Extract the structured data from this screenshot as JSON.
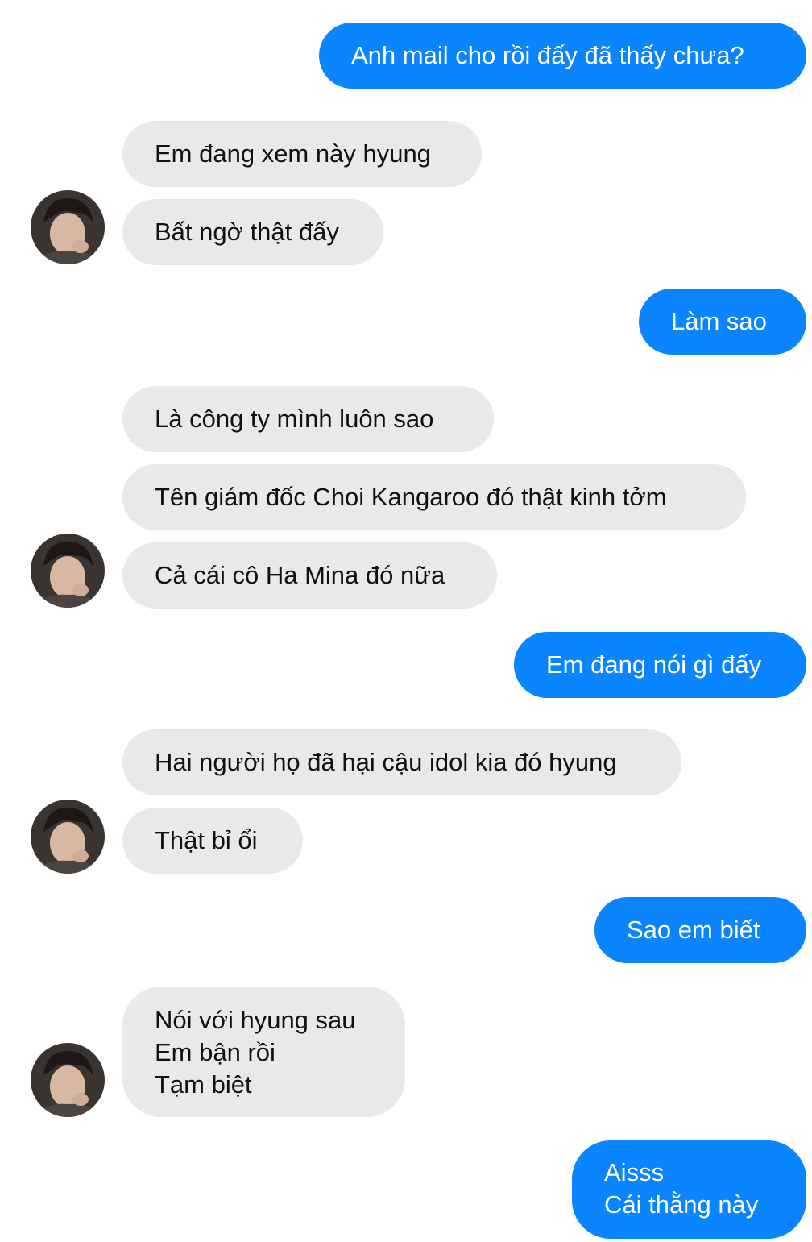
{
  "messages": [
    {
      "sender": "me",
      "text": "Anh mail cho rồi đấy đã thấy chưa?"
    },
    {
      "sender": "contact",
      "text": "Em đang xem này hyung"
    },
    {
      "sender": "contact",
      "text": "Bất ngờ thật đấy"
    },
    {
      "sender": "me",
      "text": "Làm sao"
    },
    {
      "sender": "contact",
      "text": "Là công ty mình luôn sao"
    },
    {
      "sender": "contact",
      "text": "Tên giám đốc Choi Kangaroo đó thật kinh tởm"
    },
    {
      "sender": "contact",
      "text": "Cả cái cô Ha Mina đó nữa"
    },
    {
      "sender": "me",
      "text": "Em đang nói gì đấy"
    },
    {
      "sender": "contact",
      "text": "Hai người họ đã hại cậu idol kia đó hyung"
    },
    {
      "sender": "contact",
      "text": "Thật bỉ ổi"
    },
    {
      "sender": "me",
      "text": "Sao em biết"
    },
    {
      "sender": "contact",
      "lines": [
        "Nói với hyung sau",
        "Em bận rồi",
        "Tạm biệt"
      ]
    },
    {
      "sender": "me",
      "lines": [
        "Aisss",
        "Cái thằng này"
      ]
    }
  ],
  "colors": {
    "outgoing_bubble": "#0a84ff",
    "incoming_bubble": "#e9e9eb",
    "outgoing_text": "#ffffff",
    "incoming_text": "#111111"
  },
  "contact_avatar_icon": "contact-avatar-photo"
}
